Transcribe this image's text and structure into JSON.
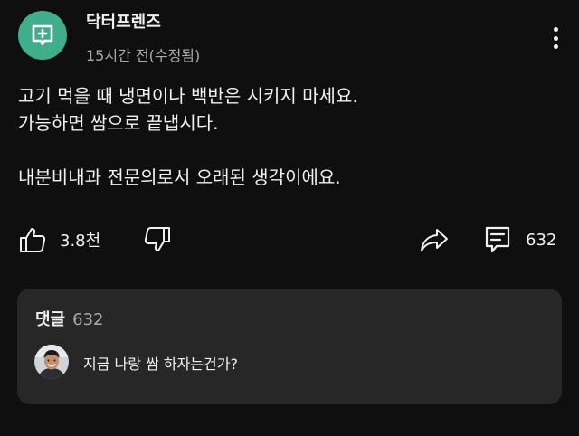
{
  "post": {
    "channel_name": "닥터프렌즈",
    "timestamp": "15시간 전(수정됨)",
    "channel_avatar_icon": "plus-square-icon",
    "channel_avatar_color": "#3fae8a",
    "body_lines": [
      "고기 먹을 때 냉면이나 백반은 시키지 마세요.",
      "가능하면 쌈으로 끝냅시다.",
      "",
      "내분비내과 전문의로서 오래된 생각이에요."
    ]
  },
  "actions": {
    "like_count": "3.8천",
    "comment_count": "632"
  },
  "comments": {
    "title": "댓글",
    "count": "632",
    "top_comment": {
      "text": "지금 나랑 쌈 하자는건가?"
    }
  },
  "colors": {
    "background": "#0f0f0f",
    "card": "#272727",
    "primary_text": "#f1f1f1",
    "secondary_text": "#aaaaaa"
  }
}
